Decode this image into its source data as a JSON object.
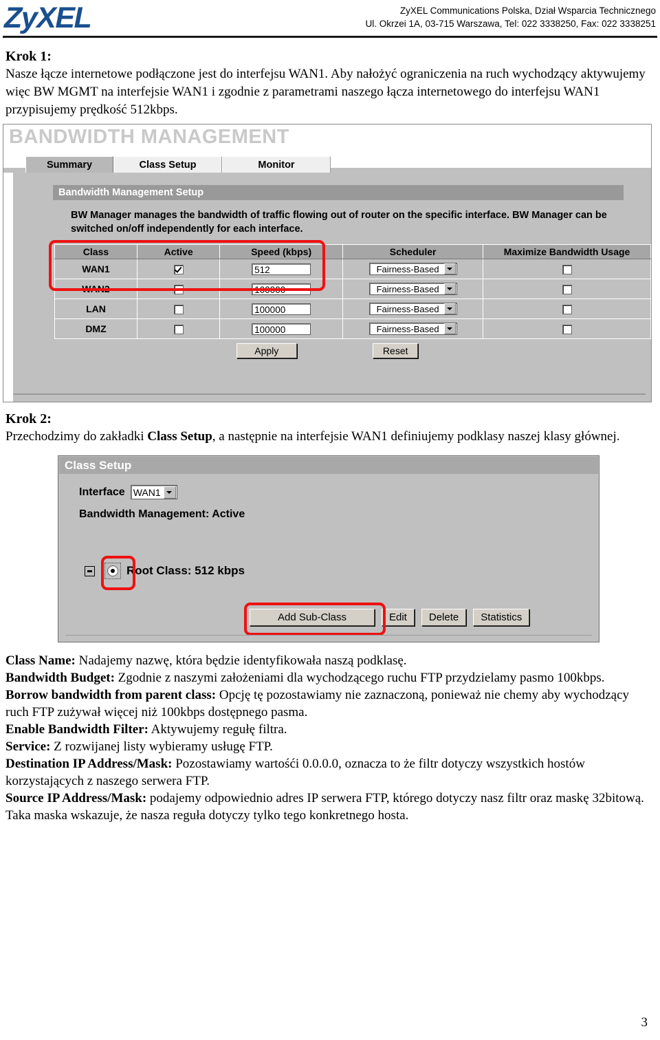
{
  "header": {
    "logo": "ZyXEL",
    "company_line1": "ZyXEL Communications Polska, Dział Wsparcia Technicznego",
    "company_line2": "Ul. Okrzei 1A, 03-715 Warszawa, Tel: 022 3338250, Fax: 022 3338251"
  },
  "step1": {
    "title": "Krok 1:",
    "paragraph": "Nasze łącze internetowe podłączone jest do interfejsu WAN1. Aby nałożyć ograniczenia na ruch wychodzący aktywujemy więc BW MGMT na interfejsie WAN1 i zgodnie z parametrami naszego łącza internetowego do interfejsu WAN1 przypisujemy prędkość 512kbps."
  },
  "screenshot1": {
    "window_title": "BANDWIDTH MANAGEMENT",
    "tabs": [
      {
        "label": "Summary",
        "active": true
      },
      {
        "label": "Class Setup",
        "active": false
      },
      {
        "label": "Monitor",
        "active": false
      }
    ],
    "section_title": "Bandwidth Management Setup",
    "description": "BW Manager manages the bandwidth of traffic flowing out of router on the specific interface. BW Manager can be switched on/off independently for each interface.",
    "table": {
      "columns": [
        "Class",
        "Active",
        "Speed (kbps)",
        "Scheduler",
        "Maximize Bandwidth Usage"
      ],
      "rows": [
        {
          "class": "WAN1",
          "active": true,
          "speed": "512",
          "scheduler": "Fairness-Based",
          "maximize": false
        },
        {
          "class": "WAN2",
          "active": false,
          "speed": "100000",
          "scheduler": "Fairness-Based",
          "maximize": false
        },
        {
          "class": "LAN",
          "active": false,
          "speed": "100000",
          "scheduler": "Fairness-Based",
          "maximize": false
        },
        {
          "class": "DMZ",
          "active": false,
          "speed": "100000",
          "scheduler": "Fairness-Based",
          "maximize": false
        }
      ]
    },
    "apply_label": "Apply",
    "reset_label": "Reset",
    "highlight_color": "#ee1111"
  },
  "step2": {
    "title": "Krok 2:",
    "paragraph_pre": "Przechodzimy do zakładki ",
    "paragraph_bold": "Class Setup",
    "paragraph_post": ", a następnie na interfejsie WAN1 definiujemy podklasy naszej klasy głównej."
  },
  "screenshot2": {
    "section_title": "Class Setup",
    "interface_label": "Interface",
    "interface_value": "WAN1",
    "bw_status": "Bandwidth Management: Active",
    "root_class": "Root Class: 512 kbps",
    "buttons": {
      "add_sub_class": "Add Sub-Class",
      "edit": "Edit",
      "delete": "Delete",
      "statistics": "Statistics"
    },
    "highlight_color": "#ee1111"
  },
  "definitions": [
    {
      "term": "Class Name:",
      "text": " Nadajemy nazwę, która będzie identyfikowała naszą podklasę."
    },
    {
      "term": "Bandwidth Budget:",
      "text": " Zgodnie z naszymi założeniami dla wychodzącego ruchu FTP przydzielamy pasmo 100kbps."
    },
    {
      "term": "Borrow bandwidth from parent class:",
      "text": " Opcję tę pozostawiamy nie zaznaczoną, ponieważ nie chemy aby wychodzący ruch FTP zużywał więcej niż 100kbps dostępnego pasma."
    },
    {
      "term": "Enable Bandwidth Filter:",
      "text": " Aktywujemy regułę filtra."
    },
    {
      "term": "Service:",
      "text": " Z rozwijanej listy wybieramy usługę FTP."
    },
    {
      "term": "Destination IP Address/Mask:",
      "text": " Pozostawiamy wartośći 0.0.0.0, oznacza to że filtr dotyczy wszystkich hostów korzystających z naszego serwera FTP."
    },
    {
      "term": "Source IP Address/Mask:",
      "text": " podajemy odpowiednio adres IP serwera FTP, którego dotyczy nasz filtr oraz maskę 32bitową. Taka maska wskazuje, że nasza reguła dotyczy tylko tego konkretnego hosta."
    }
  ],
  "page_number": "3"
}
